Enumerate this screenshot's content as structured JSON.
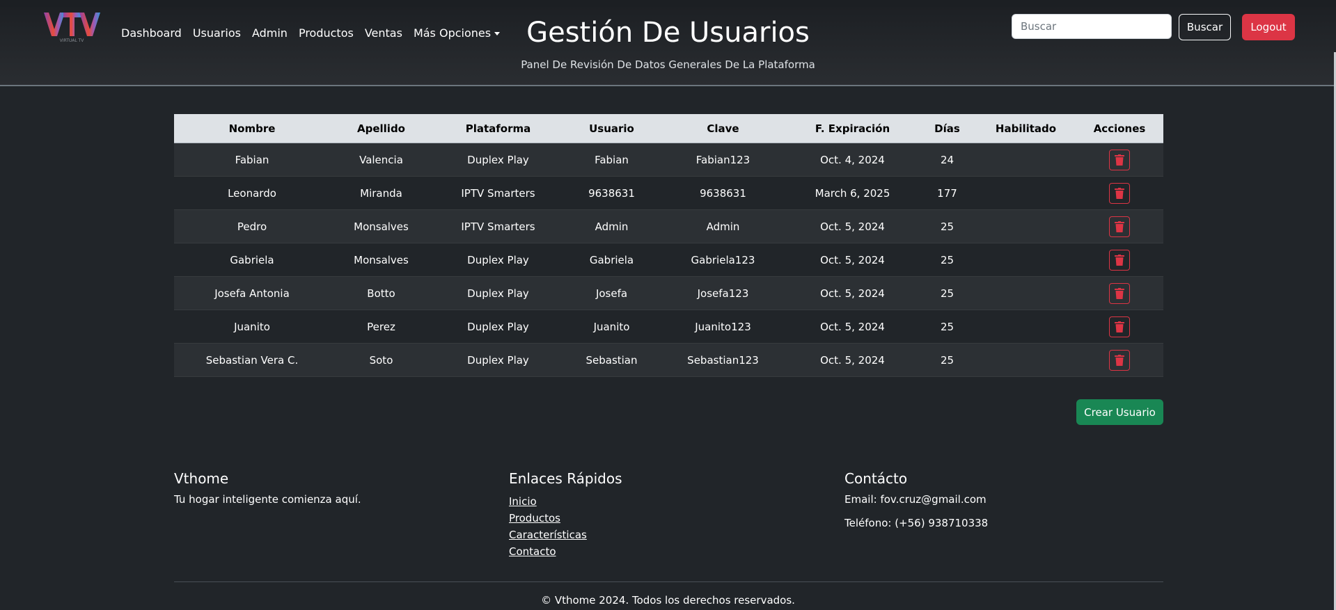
{
  "brand": {
    "logo_text": "VIRTUAL TV",
    "logo_icon": "vtv-logo"
  },
  "nav": {
    "items": [
      "Dashboard",
      "Usuarios",
      "Admin",
      "Productos",
      "Ventas"
    ],
    "more_options": "Más Opciones"
  },
  "header": {
    "title": "Gestión De Usuarios",
    "subtitle": "Panel De Revisión De Datos Generales De La Plataforma"
  },
  "search": {
    "placeholder": "Buscar",
    "button_label": "Buscar"
  },
  "logout_label": "Logout",
  "table": {
    "columns": [
      "Nombre",
      "Apellido",
      "Plataforma",
      "Usuario",
      "Clave",
      "F. Expiración",
      "Días",
      "Habilitado",
      "Acciones"
    ],
    "rows": [
      {
        "nombre": "Fabian",
        "apellido": "Valencia",
        "plataforma": "Duplex Play",
        "usuario": "Fabian",
        "clave": "Fabian123",
        "expiracion": "Oct. 4, 2024",
        "dias": "24",
        "habilitado": ""
      },
      {
        "nombre": "Leonardo",
        "apellido": "Miranda",
        "plataforma": "IPTV Smarters",
        "usuario": "9638631",
        "clave": "9638631",
        "expiracion": "March 6, 2025",
        "dias": "177",
        "habilitado": ""
      },
      {
        "nombre": "Pedro",
        "apellido": "Monsalves",
        "plataforma": "IPTV Smarters",
        "usuario": "Admin",
        "clave": "Admin",
        "expiracion": "Oct. 5, 2024",
        "dias": "25",
        "habilitado": ""
      },
      {
        "nombre": "Gabriela",
        "apellido": "Monsalves",
        "plataforma": "Duplex Play",
        "usuario": "Gabriela",
        "clave": "Gabriela123",
        "expiracion": "Oct. 5, 2024",
        "dias": "25",
        "habilitado": ""
      },
      {
        "nombre": "Josefa Antonia",
        "apellido": "Botto",
        "plataforma": "Duplex Play",
        "usuario": "Josefa",
        "clave": "Josefa123",
        "expiracion": "Oct. 5, 2024",
        "dias": "25",
        "habilitado": ""
      },
      {
        "nombre": "Juanito",
        "apellido": "Perez",
        "plataforma": "Duplex Play",
        "usuario": "Juanito",
        "clave": "Juanito123",
        "expiracion": "Oct. 5, 2024",
        "dias": "25",
        "habilitado": ""
      },
      {
        "nombre": "Sebastian Vera C.",
        "apellido": "Soto",
        "plataforma": "Duplex Play",
        "usuario": "Sebastian",
        "clave": "Sebastian123",
        "expiracion": "Oct. 5, 2024",
        "dias": "25",
        "habilitado": ""
      }
    ],
    "delete_icon": "trash-icon"
  },
  "create_user_label": "Crear Usuario",
  "footer": {
    "brand_title": "Vthome",
    "brand_tagline": "Tu hogar inteligente comienza aquí.",
    "links_title": "Enlaces Rápidos",
    "links": [
      "Inicio",
      "Productos",
      "Características",
      "Contacto"
    ],
    "contact_title": "Contácto",
    "email": "Email: fov.cruz@gmail.com",
    "phone": "Teléfono: (+56) 938710338",
    "copyright": "© Vthome 2024. Todos los derechos reservados."
  },
  "colors": {
    "background": "#212529",
    "danger": "#dc3545",
    "success": "#198754",
    "table_header": "#dee2e6"
  }
}
